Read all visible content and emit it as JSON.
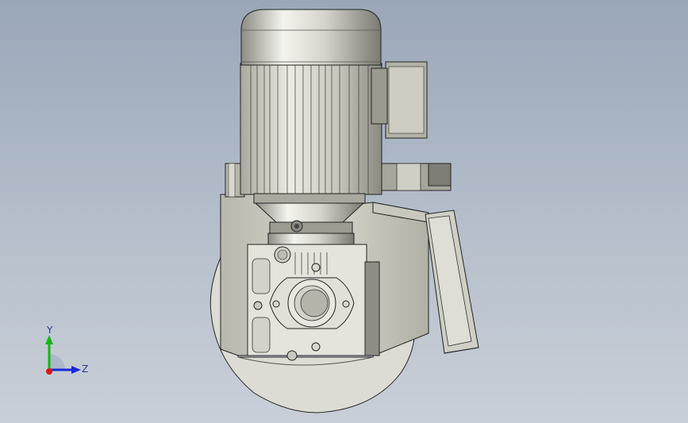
{
  "viewport": {
    "background_top": "#9aa7b9",
    "background_bottom": "#c9cfd8"
  },
  "model": {
    "colors": {
      "metal_light": "#e2e2da",
      "metal_mid": "#c3c3b8",
      "metal_dark": "#7c7c74",
      "edge": "#222222"
    }
  },
  "triad": {
    "y_label": "Y",
    "z_label": "Z",
    "colors": {
      "y": "#18b418",
      "z": "#1a2ad8",
      "x": "#d81818"
    }
  }
}
